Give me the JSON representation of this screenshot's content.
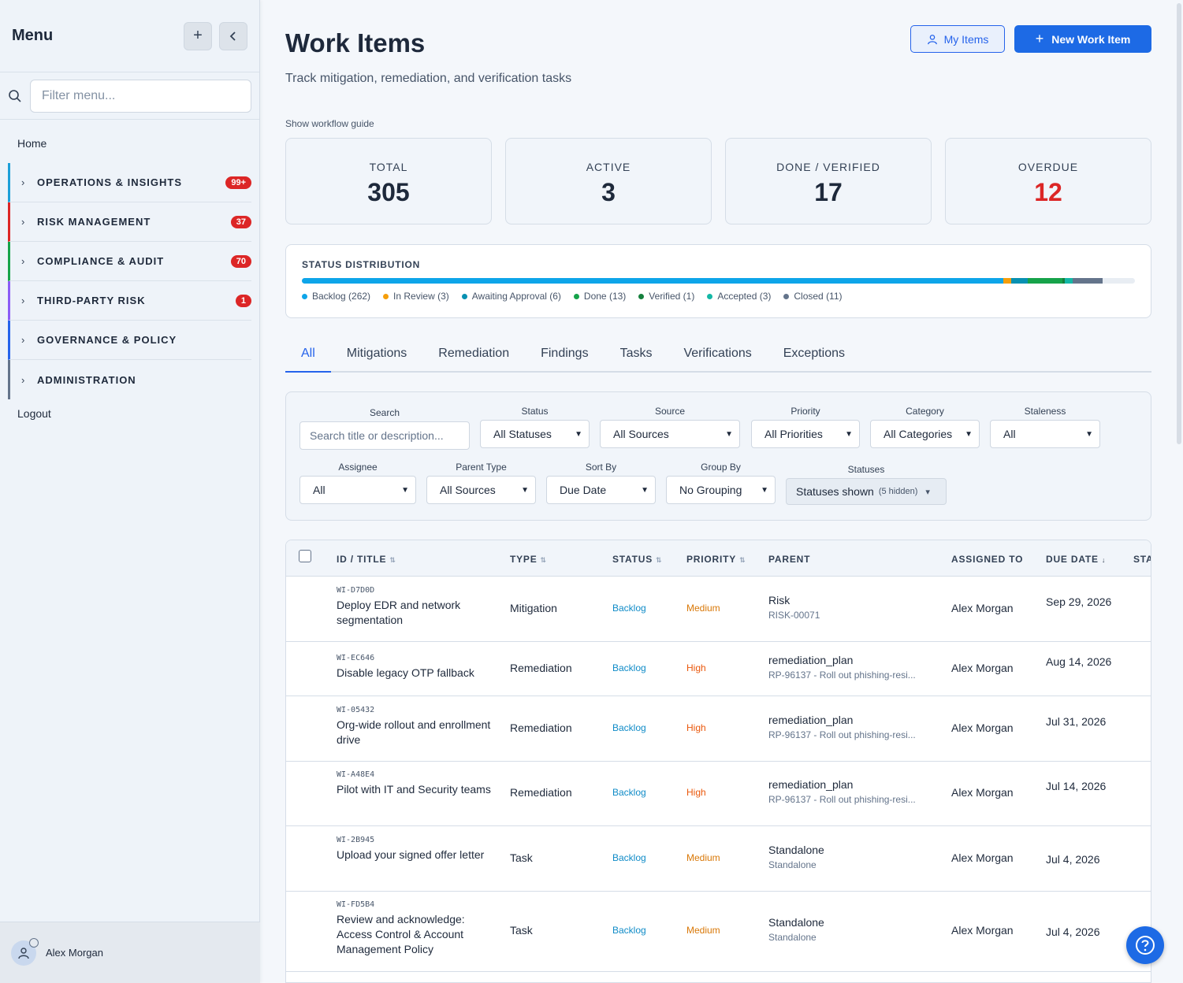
{
  "sidebar": {
    "title": "Menu",
    "filter_placeholder": "Filter menu...",
    "home": "Home",
    "sections": [
      {
        "label": "OPERATIONS & INSIGHTS",
        "badge": "99+",
        "color": "#1d9fd8"
      },
      {
        "label": "RISK MANAGEMENT",
        "badge": "37",
        "color": "#dc2626"
      },
      {
        "label": "COMPLIANCE & AUDIT",
        "badge": "70",
        "color": "#16a34a"
      },
      {
        "label": "THIRD-PARTY RISK",
        "badge": "1",
        "color": "#8b5cf6"
      },
      {
        "label": "GOVERNANCE & POLICY",
        "badge": "",
        "color": "#2563eb"
      },
      {
        "label": "ADMINISTRATION",
        "badge": "",
        "color": "#64748b"
      }
    ],
    "logout": "Logout",
    "user": "Alex Morgan"
  },
  "header": {
    "title": "Work Items",
    "subtitle": "Track mitigation, remediation, and verification tasks",
    "my_items": "My Items",
    "new_item": "New Work Item",
    "guide": "Show workflow guide"
  },
  "stats": [
    {
      "label": "TOTAL",
      "value": "305"
    },
    {
      "label": "ACTIVE",
      "value": "3"
    },
    {
      "label": "DONE / VERIFIED",
      "value": "17"
    },
    {
      "label": "OVERDUE",
      "value": "12"
    }
  ],
  "distribution": {
    "title": "STATUS DISTRIBUTION",
    "segments": [
      {
        "label": "Backlog (262)",
        "count": 262,
        "color": "#0ea5e9"
      },
      {
        "label": "In Review (3)",
        "count": 3,
        "color": "#f59e0b"
      },
      {
        "label": "Awaiting Approval (6)",
        "count": 6,
        "color": "#0891b2"
      },
      {
        "label": "Done (13)",
        "count": 13,
        "color": "#16a34a"
      },
      {
        "label": "Verified (1)",
        "count": 1,
        "color": "#15803d"
      },
      {
        "label": "Accepted (3)",
        "count": 3,
        "color": "#14b8a6"
      },
      {
        "label": "Closed (11)",
        "count": 11,
        "color": "#64748b"
      }
    ]
  },
  "tabs": [
    "All",
    "Mitigations",
    "Remediation",
    "Findings",
    "Tasks",
    "Verifications",
    "Exceptions"
  ],
  "filters": {
    "search_label": "Search",
    "search_placeholder": "Search title or description...",
    "status_label": "Status",
    "status_value": "All Statuses",
    "source_label": "Source",
    "source_value": "All Sources",
    "priority_label": "Priority",
    "priority_value": "All Priorities",
    "category_label": "Category",
    "category_value": "All Categories",
    "staleness_label": "Staleness",
    "staleness_value": "All",
    "assignee_label": "Assignee",
    "assignee_value": "All",
    "parent_type_label": "Parent Type",
    "parent_type_value": "All Sources",
    "sort_label": "Sort By",
    "sort_value": "Due Date",
    "group_label": "Group By",
    "group_value": "No Grouping",
    "statuses_label": "Statuses",
    "statuses_value": "Statuses shown",
    "statuses_hidden": "(5 hidden)"
  },
  "table": {
    "headers": {
      "id_title": "ID / TITLE",
      "type": "TYPE",
      "status": "STATUS",
      "priority": "PRIORITY",
      "parent": "PARENT",
      "assigned": "ASSIGNED TO",
      "due": "DUE DATE",
      "sta": "STA"
    },
    "rows": [
      {
        "id": "WI-D7D0D",
        "title": "Deploy EDR and network segmentation",
        "type": "Mitigation",
        "status": "Backlog",
        "priority": "Medium",
        "parent_type": "Risk",
        "parent_sub": "RISK-00071",
        "assignee": "Alex Morgan",
        "due": "Sep 29, 2026"
      },
      {
        "id": "WI-EC646",
        "title": "Disable legacy OTP fallback",
        "type": "Remediation",
        "status": "Backlog",
        "priority": "High",
        "parent_type": "remediation_plan",
        "parent_sub": "RP-96137 - Roll out phishing-resi...",
        "assignee": "Alex Morgan",
        "due": "Aug 14, 2026"
      },
      {
        "id": "WI-05432",
        "title": "Org-wide rollout and enrollment drive",
        "type": "Remediation",
        "status": "Backlog",
        "priority": "High",
        "parent_type": "remediation_plan",
        "parent_sub": "RP-96137 - Roll out phishing-resi...",
        "assignee": "Alex Morgan",
        "due": "Jul 31, 2026"
      },
      {
        "id": "WI-A48E4",
        "title": "Pilot with IT and Security teams",
        "type": "Remediation",
        "status": "Backlog",
        "priority": "High",
        "parent_type": "remediation_plan",
        "parent_sub": "RP-96137 - Roll out phishing-resi...",
        "assignee": "Alex Morgan",
        "due": "Jul 14, 2026"
      },
      {
        "id": "WI-2B945",
        "title": "Upload your signed offer letter",
        "type": "Task",
        "status": "Backlog",
        "priority": "Medium",
        "parent_type": "Standalone",
        "parent_sub": "Standalone",
        "assignee": "Alex Morgan",
        "due": "Jul 4, 2026"
      },
      {
        "id": "WI-FD5B4",
        "title": "Review and acknowledge: Access Control & Account Management Policy",
        "type": "Task",
        "status": "Backlog",
        "priority": "Medium",
        "parent_type": "Standalone",
        "parent_sub": "Standalone",
        "assignee": "Alex Morgan",
        "due": "Jul 4, 2026"
      }
    ]
  }
}
